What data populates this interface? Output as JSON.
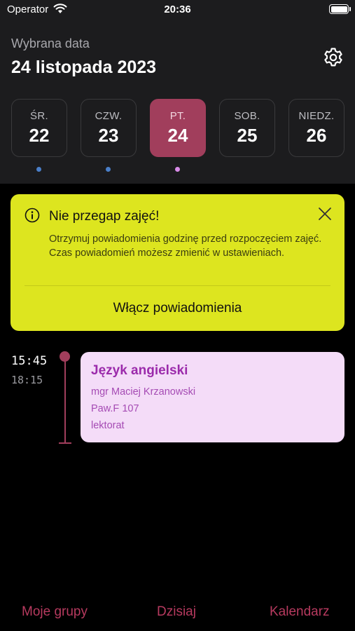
{
  "status_bar": {
    "carrier": "Operator",
    "time": "20:36"
  },
  "header": {
    "caption": "Wybrana data",
    "date": "24 listopada 2023"
  },
  "days": [
    {
      "name": "ŚR.",
      "num": "22",
      "selected": false
    },
    {
      "name": "CZW.",
      "num": "23",
      "selected": false
    },
    {
      "name": "PT.",
      "num": "24",
      "selected": true
    },
    {
      "name": "SOB.",
      "num": "25",
      "selected": false
    },
    {
      "name": "NIEDZ.",
      "num": "26",
      "selected": false
    }
  ],
  "banner": {
    "title": "Nie przegap zajęć!",
    "body": "Otrzymuj powiadomienia godzinę przed rozpoczęciem zajęć. Czas powiadomień możesz zmienić w ustawieniach.",
    "action": "Włącz powiadomienia"
  },
  "class": {
    "start": "15:45",
    "end": "18:15",
    "title": "Język angielski",
    "teacher": "mgr Maciej Krzanowski",
    "room": "Paw.F 107",
    "type": "lektorat"
  },
  "tabs": {
    "groups": "Moje grupy",
    "today": "Dzisiaj",
    "calendar": "Kalendarz"
  },
  "colors": {
    "accent": "#a13e5c",
    "banner": "#dde51f",
    "card": "#f4dcf8",
    "dot_blue": "#4a7fc9",
    "dot_pink": "#d88be8"
  },
  "icons": {
    "wifi": "wifi-icon",
    "battery": "battery-icon",
    "settings": "gear-icon",
    "info": "info-icon",
    "close": "close-icon"
  }
}
